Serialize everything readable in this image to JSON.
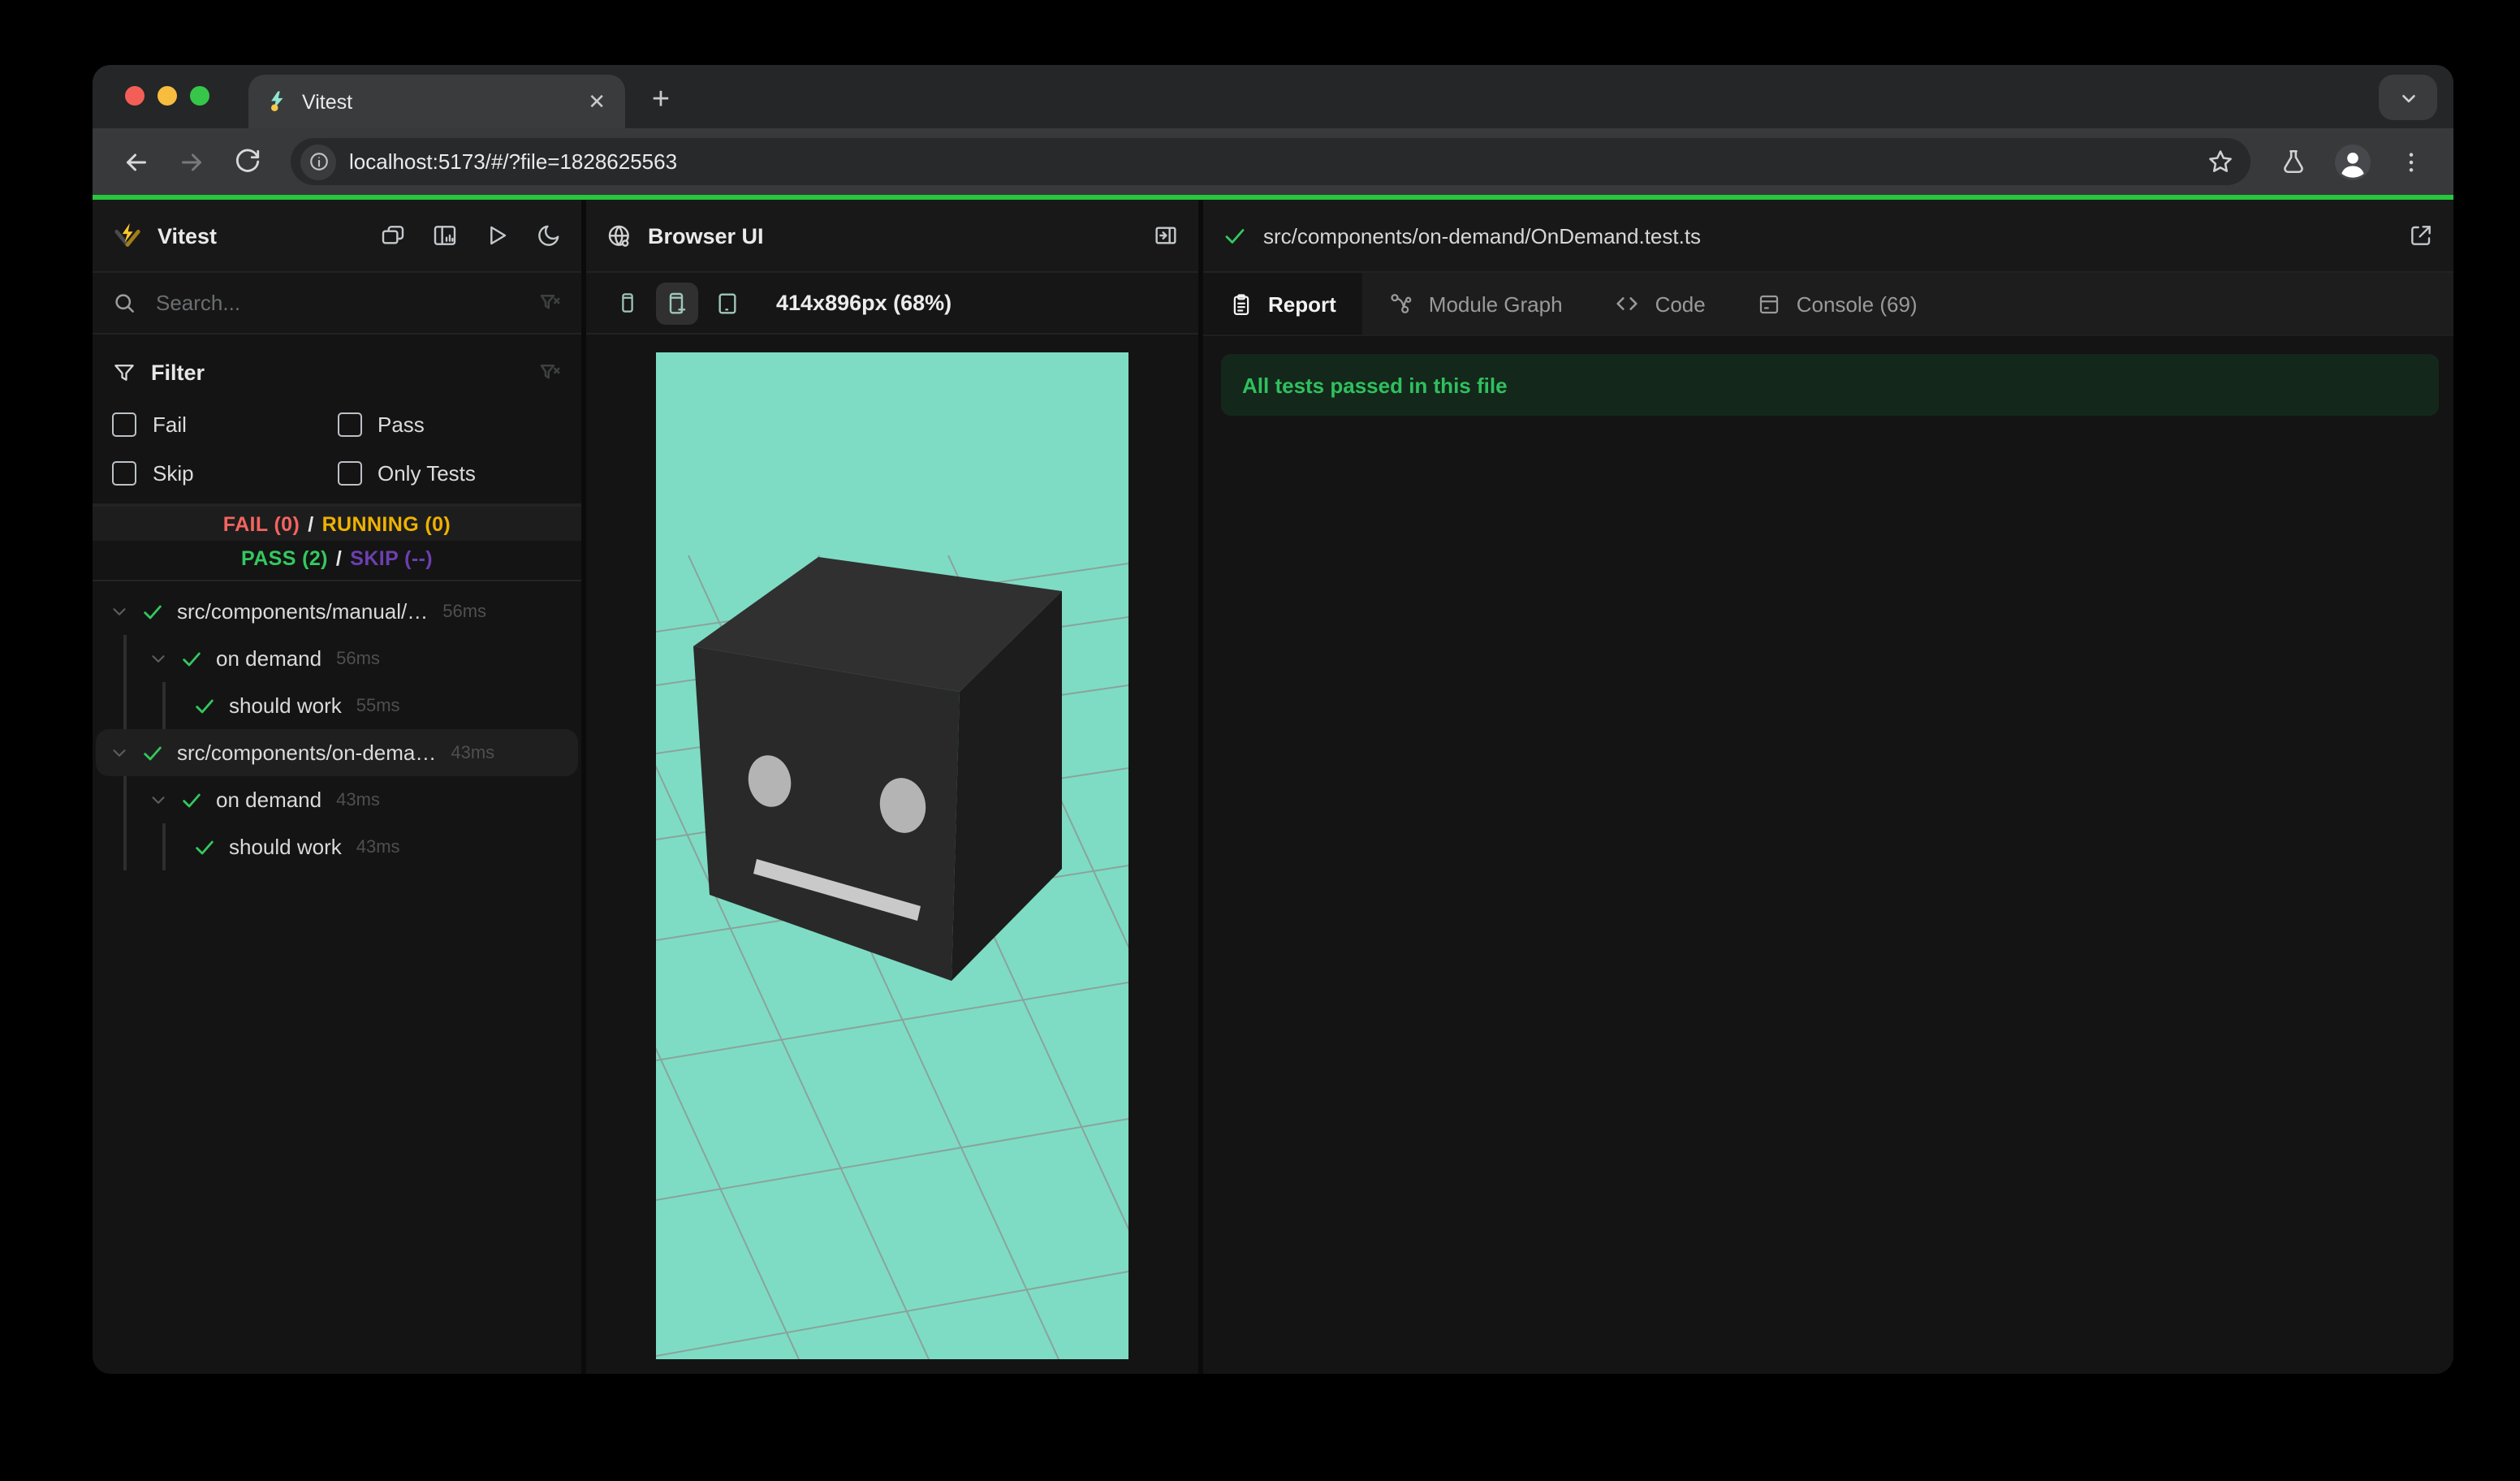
{
  "browser": {
    "tab_title": "Vitest",
    "url": "localhost:5173/#/?file=1828625563"
  },
  "sidebar": {
    "app_title": "Vitest",
    "search_placeholder": "Search...",
    "filter": {
      "title": "Filter",
      "options": [
        {
          "label": "Fail",
          "checked": false
        },
        {
          "label": "Pass",
          "checked": false
        },
        {
          "label": "Skip",
          "checked": false
        },
        {
          "label": "Only Tests",
          "checked": false
        }
      ]
    },
    "status": {
      "fail": "FAIL (0)",
      "running": "RUNNING (0)",
      "pass": "PASS (2)",
      "skip": "SKIP (--)",
      "separator": "/"
    },
    "tree": [
      {
        "depth": 0,
        "label": "src/components/manual/…",
        "duration": "56ms",
        "expanded": true,
        "status": "pass",
        "selected": false
      },
      {
        "depth": 1,
        "label": "on demand",
        "duration": "56ms",
        "expanded": true,
        "status": "pass",
        "selected": false
      },
      {
        "depth": 2,
        "label": "should work",
        "duration": "55ms",
        "status": "pass",
        "selected": false
      },
      {
        "depth": 0,
        "label": "src/components/on-dema…",
        "duration": "43ms",
        "expanded": true,
        "status": "pass",
        "selected": true
      },
      {
        "depth": 1,
        "label": "on demand",
        "duration": "43ms",
        "expanded": true,
        "status": "pass",
        "selected": false
      },
      {
        "depth": 2,
        "label": "should work",
        "duration": "43ms",
        "status": "pass",
        "selected": false
      }
    ]
  },
  "preview": {
    "title": "Browser UI",
    "dimensions_label": "414x896px (68%)",
    "devices": [
      {
        "name": "mobile-small",
        "active": false
      },
      {
        "name": "mobile-plus",
        "active": true
      },
      {
        "name": "tablet",
        "active": false
      }
    ]
  },
  "results": {
    "file_path": "src/components/on-demand/OnDemand.test.ts",
    "tabs": [
      {
        "label": "Report",
        "icon": "clipboard",
        "active": true
      },
      {
        "label": "Module Graph",
        "icon": "graph",
        "active": false
      },
      {
        "label": "Code",
        "icon": "code",
        "active": false
      },
      {
        "label": "Console (69)",
        "icon": "console",
        "active": false
      }
    ],
    "banner": "All tests passed in this file"
  },
  "colors": {
    "progress_green": "#27c840",
    "pass_green": "#34c85f",
    "fail_red": "#f4645f",
    "running_yellow": "#efb100",
    "skip_purple": "#6d3fb0",
    "viewport_teal": "#7edcc4",
    "banner_bg": "#14271b",
    "banner_text": "#2fc05e"
  }
}
